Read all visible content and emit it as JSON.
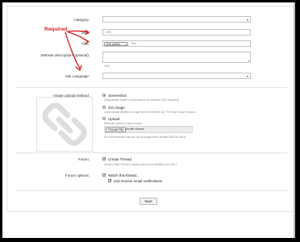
{
  "annotation": {
    "required_label": "Required"
  },
  "form": {
    "category_label": "Category:",
    "url_label": "URL:",
    "url_placeholder": "URL",
    "title_label": "Title:",
    "prefix_value": "(No prefix)",
    "title_placeholder": "Title",
    "description_label": "Website description (optional):",
    "description_counter": "1000",
    "site_language_label": "Site Language:",
    "image_method_label": "Image upload method:",
    "image_options": [
      {
        "label": "Screenshot",
        "hint": "Automatically create a Screenshot of the Website (URL Required)",
        "selected": true
      },
      {
        "label": "OG Image",
        "hint": "Automatically creates an image from the Website og: / The Open Graph protocol",
        "selected": false
      },
      {
        "label": "Upload",
        "hint": "Manually Upload a custom image",
        "selected": false
      }
    ],
    "choose_file_label": "Choose File",
    "no_file_text": "No file chosen",
    "upload_hint": "It is recommended that you use an image that is at least 300x220 pixels.",
    "forum_label": "Forum:",
    "create_thread_label": "Create Thread",
    "create_thread_hint": "Create a New Thread to discuss about your Website Link (URL).",
    "forum_options_label": "Forum options:",
    "watch_thread_label": "Watch this thread...",
    "email_notifications_label": "and receive email notifications",
    "save_label": "Save"
  },
  "colors": {
    "annotation": "#d21f1f",
    "border": "#c3c3c3",
    "hint": "#8a8a8a",
    "placeholder_image": "#dedede"
  },
  "icons": {
    "image_placeholder": "link-icon",
    "annotation_arrows": "red-arrow-icon"
  }
}
